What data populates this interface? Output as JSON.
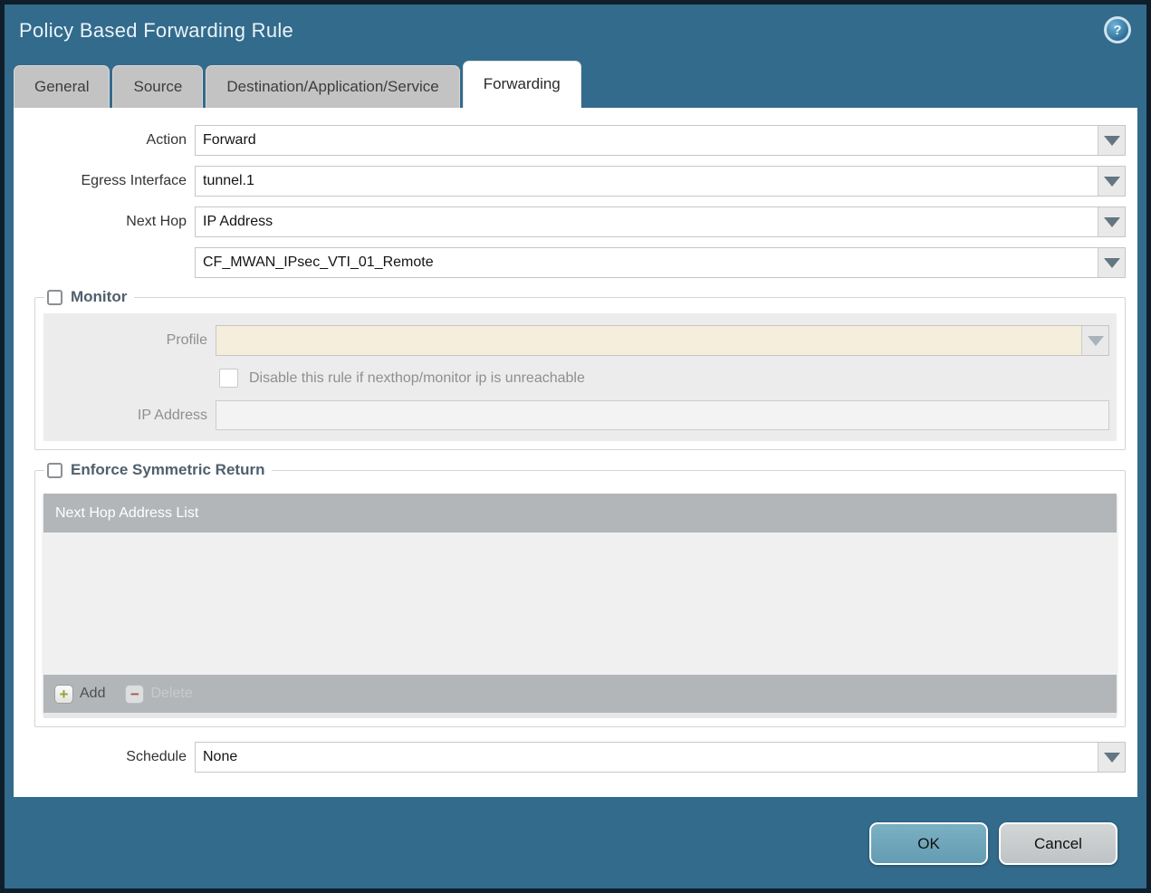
{
  "window": {
    "title": "Policy Based Forwarding Rule"
  },
  "icons": {
    "help": "?",
    "dropdown": "triangle-down",
    "add": "+",
    "delete": "−"
  },
  "tabs": [
    {
      "label": "General",
      "active": false
    },
    {
      "label": "Source",
      "active": false
    },
    {
      "label": "Destination/Application/Service",
      "active": false
    },
    {
      "label": "Forwarding",
      "active": true
    }
  ],
  "form": {
    "action": {
      "label": "Action",
      "value": "Forward"
    },
    "egress_interface": {
      "label": "Egress Interface",
      "value": "tunnel.1"
    },
    "next_hop": {
      "label": "Next Hop",
      "value": "IP Address"
    },
    "next_hop_address": {
      "value": "CF_MWAN_IPsec_VTI_01_Remote"
    },
    "schedule": {
      "label": "Schedule",
      "value": "None"
    }
  },
  "monitor": {
    "label": "Monitor",
    "checked": false,
    "profile": {
      "label": "Profile",
      "value": ""
    },
    "disable_rule": {
      "label": "Disable this rule if nexthop/monitor ip is unreachable",
      "checked": false
    },
    "ip_address": {
      "label": "IP Address",
      "value": ""
    }
  },
  "enforce_symmetric_return": {
    "label": "Enforce Symmetric Return",
    "checked": false,
    "table": {
      "header": "Next Hop Address List",
      "rows": []
    },
    "add_label": "Add",
    "delete_label": "Delete"
  },
  "footer": {
    "ok_label": "OK",
    "cancel_label": "Cancel"
  },
  "colors": {
    "frame_teal": "#336b8c",
    "window_border": "#0e1f2b",
    "tab_inactive": "#c3c3c3",
    "section_label": "#4f5f6d",
    "disabled_field_beige": "#f5eedc",
    "table_gray": "#b3b6b9",
    "add_green": "#8ea43e",
    "delete_red": "#a85757",
    "ok_button": "#6fa7bc",
    "cancel_button": "#c8ccce"
  }
}
